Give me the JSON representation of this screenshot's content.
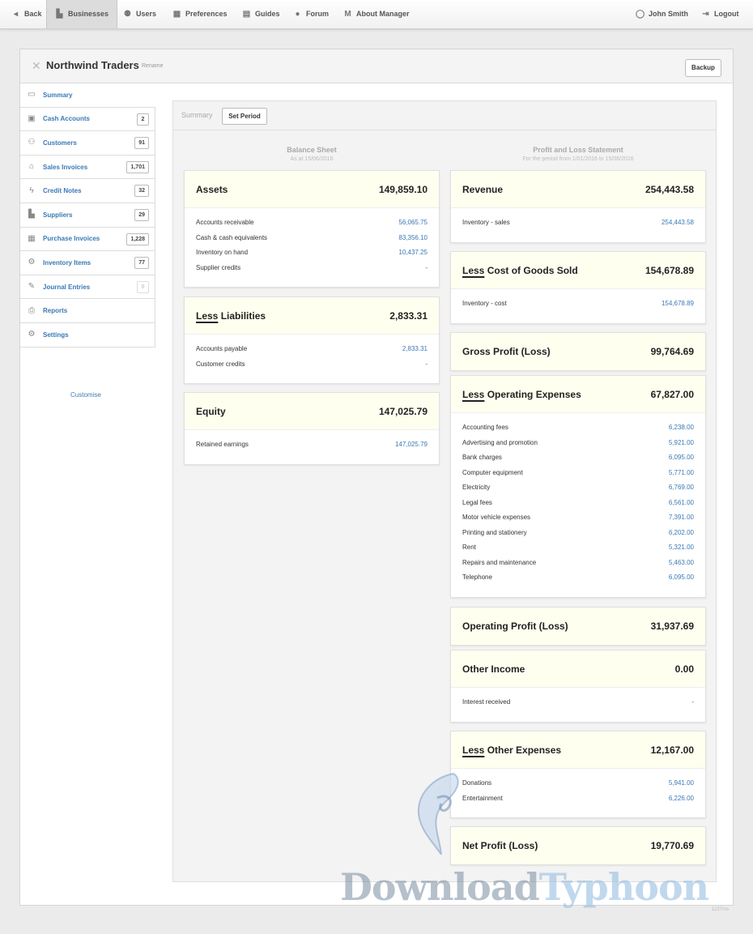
{
  "nav": {
    "back": "Back",
    "businesses": "Businesses",
    "users": "Users",
    "preferences": "Preferences",
    "guides": "Guides",
    "forum": "Forum",
    "about": "About Manager",
    "user": "John Smith",
    "logout": "Logout"
  },
  "business": {
    "name": "Northwind Traders",
    "rename": "Rename",
    "backup": "Backup"
  },
  "sidebar": {
    "items": [
      {
        "label": "Summary",
        "count": ""
      },
      {
        "label": "Cash Accounts",
        "count": "2"
      },
      {
        "label": "Customers",
        "count": "91"
      },
      {
        "label": "Sales Invoices",
        "count": "1,701"
      },
      {
        "label": "Credit Notes",
        "count": "32"
      },
      {
        "label": "Suppliers",
        "count": "29"
      },
      {
        "label": "Purchase Invoices",
        "count": "1,228"
      },
      {
        "label": "Inventory Items",
        "count": "77"
      },
      {
        "label": "Journal Entries",
        "count": "0"
      },
      {
        "label": "Reports",
        "count": ""
      },
      {
        "label": "Settings",
        "count": ""
      }
    ],
    "customise": "Customise"
  },
  "summary": {
    "tab_summary": "Summary",
    "set_period": "Set Period",
    "balance_sheet": {
      "title": "Balance Sheet",
      "subtitle": "As at 15/06/2016",
      "assets": {
        "title": "Assets",
        "total": "149,859.10",
        "rows": [
          {
            "label": "Accounts receivable",
            "value": "56,065.75"
          },
          {
            "label": "Cash & cash equivalents",
            "value": "83,356.10"
          },
          {
            "label": "Inventory on hand",
            "value": "10,437.25"
          },
          {
            "label": "Supplier credits",
            "value": "-"
          }
        ]
      },
      "liabilities": {
        "less": "Less",
        "title": "Liabilities",
        "total": "2,833.31",
        "rows": [
          {
            "label": "Accounts payable",
            "value": "2,833.31"
          },
          {
            "label": "Customer credits",
            "value": "-"
          }
        ]
      },
      "equity": {
        "title": "Equity",
        "total": "147,025.79",
        "rows": [
          {
            "label": "Retained earnings",
            "value": "147,025.79"
          }
        ]
      }
    },
    "profit_loss": {
      "title": "Profit and Loss Statement",
      "subtitle": "For the period from 1/01/2016 to 15/06/2016",
      "revenue": {
        "title": "Revenue",
        "total": "254,443.58",
        "rows": [
          {
            "label": "Inventory - sales",
            "value": "254,443.58"
          }
        ]
      },
      "cogs": {
        "less": "Less",
        "title": "Cost of Goods Sold",
        "total": "154,678.89",
        "rows": [
          {
            "label": "Inventory - cost",
            "value": "154,678.89"
          }
        ]
      },
      "gross": {
        "title": "Gross Profit (Loss)",
        "total": "99,764.69"
      },
      "opex": {
        "less": "Less",
        "title": "Operating Expenses",
        "total": "67,827.00",
        "rows": [
          {
            "label": "Accounting fees",
            "value": "6,238.00"
          },
          {
            "label": "Advertising and promotion",
            "value": "5,921.00"
          },
          {
            "label": "Bank charges",
            "value": "6,095.00"
          },
          {
            "label": "Computer equipment",
            "value": "5,771.00"
          },
          {
            "label": "Electricity",
            "value": "6,769.00"
          },
          {
            "label": "Legal fees",
            "value": "6,561.00"
          },
          {
            "label": "Motor vehicle expenses",
            "value": "7,391.00"
          },
          {
            "label": "Printing and stationery",
            "value": "6,202.00"
          },
          {
            "label": "Rent",
            "value": "5,321.00"
          },
          {
            "label": "Repairs and maintenance",
            "value": "5,463.00"
          },
          {
            "label": "Telephone",
            "value": "6,095.00"
          }
        ]
      },
      "operating": {
        "title": "Operating Profit (Loss)",
        "total": "31,937.69"
      },
      "other_income": {
        "title": "Other Income",
        "total": "0.00",
        "rows": [
          {
            "label": "Interest received",
            "value": "-"
          }
        ]
      },
      "other_expenses": {
        "less": "Less",
        "title": "Other Expenses",
        "total": "12,167.00",
        "rows": [
          {
            "label": "Donations",
            "value": "5,941.00"
          },
          {
            "label": "Entertainment",
            "value": "6,226.00"
          }
        ]
      },
      "net": {
        "title": "Net Profit (Loss)",
        "total": "19,770.69"
      }
    }
  },
  "watermark": {
    "part1": "Download",
    "part2": "Typhoon"
  },
  "footer_note": "1237ms",
  "colors": {
    "link": "#3a78b5",
    "card_head": "#fffff0",
    "background": "#ebebeb"
  }
}
